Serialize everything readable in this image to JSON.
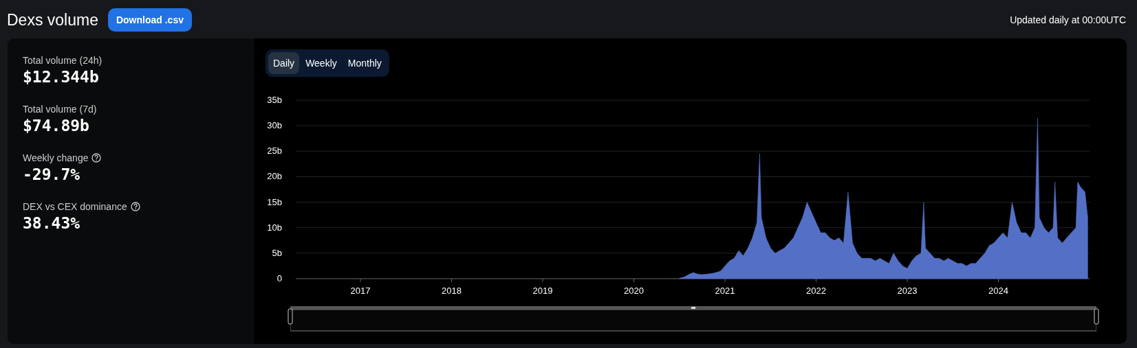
{
  "header": {
    "title": "Dexs volume",
    "download_button": "Download .csv",
    "update_note": "Updated daily at 00:00UTC"
  },
  "stats": [
    {
      "label": "Total volume (24h)",
      "value": "$12.344b",
      "help": false
    },
    {
      "label": "Total volume (7d)",
      "value": "$74.89b",
      "help": false
    },
    {
      "label": "Weekly change",
      "value": "-29.7%",
      "help": true
    },
    {
      "label": "DEX vs CEX dominance",
      "value": "38.43%",
      "help": true
    }
  ],
  "period_tabs": [
    {
      "label": "Daily",
      "selected": true
    },
    {
      "label": "Weekly",
      "selected": false
    },
    {
      "label": "Monthly",
      "selected": false
    }
  ],
  "range_slider": {
    "level": 1.0
  },
  "chart_data": {
    "type": "area",
    "grid": true,
    "xlim": [
      2016.29,
      2025.0
    ],
    "ylim": [
      0,
      35
    ],
    "xticks": [
      {
        "value": 2017,
        "label": "2017"
      },
      {
        "value": 2018,
        "label": "2018"
      },
      {
        "value": 2019,
        "label": "2019"
      },
      {
        "value": 2020,
        "label": "2020"
      },
      {
        "value": 2021,
        "label": "2021"
      },
      {
        "value": 2022,
        "label": "2022"
      },
      {
        "value": 2023,
        "label": "2023"
      },
      {
        "value": 2024,
        "label": "2024"
      }
    ],
    "yticks": [
      {
        "value": 0,
        "label": "0"
      },
      {
        "value": 5,
        "label": "5b"
      },
      {
        "value": 10,
        "label": "10b"
      },
      {
        "value": 15,
        "label": "15b"
      },
      {
        "value": 20,
        "label": "20b"
      },
      {
        "value": 25,
        "label": "25b"
      },
      {
        "value": 30,
        "label": "30b"
      },
      {
        "value": 35,
        "label": "35b"
      }
    ],
    "x": [
      2020.5,
      2020.55,
      2020.6,
      2020.65,
      2020.7,
      2020.75,
      2020.8,
      2020.85,
      2020.9,
      2020.95,
      2021.0,
      2021.05,
      2021.1,
      2021.15,
      2021.2,
      2021.25,
      2021.3,
      2021.35,
      2021.38,
      2021.4,
      2021.45,
      2021.5,
      2021.55,
      2021.6,
      2021.65,
      2021.7,
      2021.75,
      2021.8,
      2021.85,
      2021.9,
      2021.95,
      2022.0,
      2022.05,
      2022.1,
      2022.15,
      2022.2,
      2022.25,
      2022.3,
      2022.35,
      2022.4,
      2022.45,
      2022.5,
      2022.55,
      2022.6,
      2022.65,
      2022.7,
      2022.75,
      2022.8,
      2022.85,
      2022.9,
      2022.95,
      2023.0,
      2023.05,
      2023.1,
      2023.15,
      2023.18,
      2023.2,
      2023.25,
      2023.3,
      2023.35,
      2023.4,
      2023.45,
      2023.5,
      2023.55,
      2023.6,
      2023.65,
      2023.7,
      2023.75,
      2023.8,
      2023.85,
      2023.9,
      2023.95,
      2024.0,
      2024.05,
      2024.1,
      2024.15,
      2024.2,
      2024.25,
      2024.3,
      2024.35,
      2024.4,
      2024.43,
      2024.45,
      2024.5,
      2024.55,
      2024.6,
      2024.62,
      2024.65,
      2024.7,
      2024.75,
      2024.8,
      2024.85,
      2024.87,
      2024.9,
      2024.95,
      2024.98
    ],
    "series": [
      {
        "color": "#5470c6",
        "values": [
          0.1,
          0.3,
          0.8,
          1.2,
          0.9,
          0.8,
          0.9,
          1.0,
          1.2,
          1.5,
          2.5,
          3.5,
          4,
          5.5,
          4.5,
          6,
          8,
          11,
          24.5,
          12,
          8,
          6,
          5,
          5.5,
          6,
          7,
          8,
          10,
          12,
          15,
          13,
          11,
          9,
          9,
          8,
          7.5,
          8,
          7,
          17,
          7,
          5,
          4,
          4,
          4,
          3.5,
          4,
          3.5,
          3,
          5,
          3.5,
          2.5,
          2,
          3.5,
          4.5,
          5,
          15,
          6,
          5,
          4,
          4,
          3.5,
          4,
          3.5,
          3,
          3,
          2.5,
          3,
          3,
          4,
          5,
          6.5,
          7,
          8,
          9,
          8,
          15,
          11,
          9,
          9,
          8,
          10,
          31.5,
          12,
          10,
          9,
          10,
          19,
          8,
          7,
          8,
          9,
          10,
          19,
          18,
          17,
          12
        ]
      }
    ]
  }
}
